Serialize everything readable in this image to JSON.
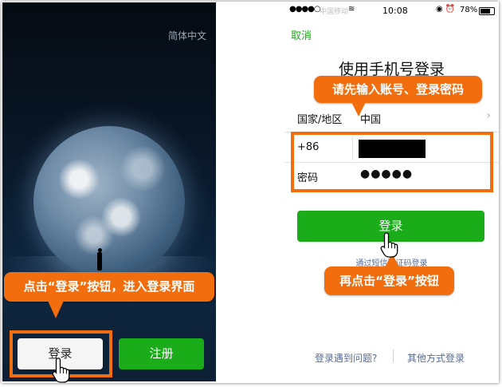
{
  "left_screen": {
    "language_link": "简体中文",
    "callout": "点击“登录”按钮，进入登录界面",
    "login_button": "登录",
    "register_button": "注册"
  },
  "right_screen": {
    "status_bar": {
      "signal": "●●●●○",
      "carrier": "中国移动",
      "wifi": "≋",
      "time": "10:08",
      "status_icons": "◉ ⏰",
      "battery": "78%"
    },
    "cancel": "取消",
    "title": "使用手机号登录",
    "callout_top": "请先输入账号、登录密码",
    "country_label": "国家/地区",
    "country_value": "中国",
    "country_chevron": "›",
    "phone_prefix": "+86",
    "password_label": "密码",
    "password_value": "●●●●●",
    "login_button": "登录",
    "sms_link": "通过短信验证码登录",
    "callout_bottom": "再点击“登录”按钮",
    "link_problem": "登录遇到问题?",
    "link_other": "其他方式登录"
  },
  "colors": {
    "accent_green": "#1aad19",
    "callout_orange": "#f26d0e",
    "link_blue": "#576b95"
  },
  "icons": [
    "hand-pointer-icon",
    "chevron-right-icon",
    "wifi-icon",
    "battery-icon"
  ]
}
